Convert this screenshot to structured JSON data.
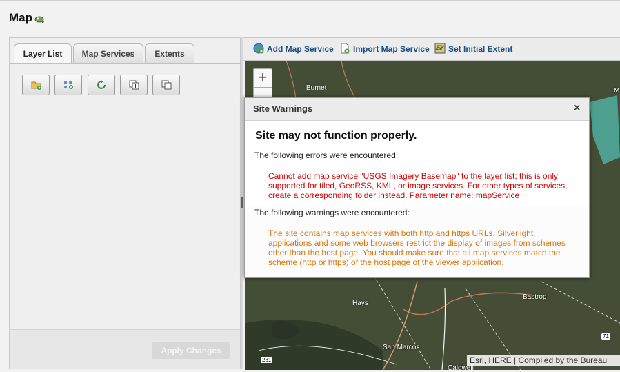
{
  "page": {
    "title": "Map",
    "title_icon": "map-link-icon"
  },
  "left_panel": {
    "tabs": [
      {
        "label": "Layer List",
        "active": true
      },
      {
        "label": "Map Services",
        "active": false
      },
      {
        "label": "Extents",
        "active": false
      }
    ],
    "tools": [
      "add-folder-icon",
      "add-layer-group-icon",
      "refresh-icon",
      "expand-all-icon",
      "collapse-all-icon"
    ],
    "apply_label": "Apply Changes"
  },
  "map_toolbar": {
    "add_service": "Add Map Service",
    "import_service": "Import Map Service",
    "set_extent": "Set Initial Extent"
  },
  "map": {
    "zoom_in": "+",
    "labels": {
      "burnet": "Burnet",
      "hays": "Hays",
      "bastrop": "Bastrop",
      "san_marcos": "San Marcos",
      "m": "M",
      "caldwell": "Caldwell"
    },
    "shields": {
      "r281": "281",
      "r71": "71"
    },
    "attribution": "Esri, HERE | Compiled by the Bureau"
  },
  "dialog": {
    "title": "Site Warnings",
    "close": "×",
    "heading": "Site may not function properly.",
    "errors_label": "The following errors were encountered:",
    "error_msg": "Cannot add map service \"USGS Imagery Basemap\" to the layer list; this is only supported for tiled, GeoRSS, KML, or image services. For other types of services, create a corresponding folder instead. Parameter name: mapService",
    "warnings_label": "The following warnings were encountered:",
    "warning_msg": "The site contains map services with both http and https URLs. Silverlight applications and some web browsers restrict the display of images from schemes other than the host page. You should make sure that all map services match the scheme (http or https) of the host page of the viewer application.",
    "colors": {
      "error": "#d10000",
      "warning": "#d9770b"
    }
  }
}
